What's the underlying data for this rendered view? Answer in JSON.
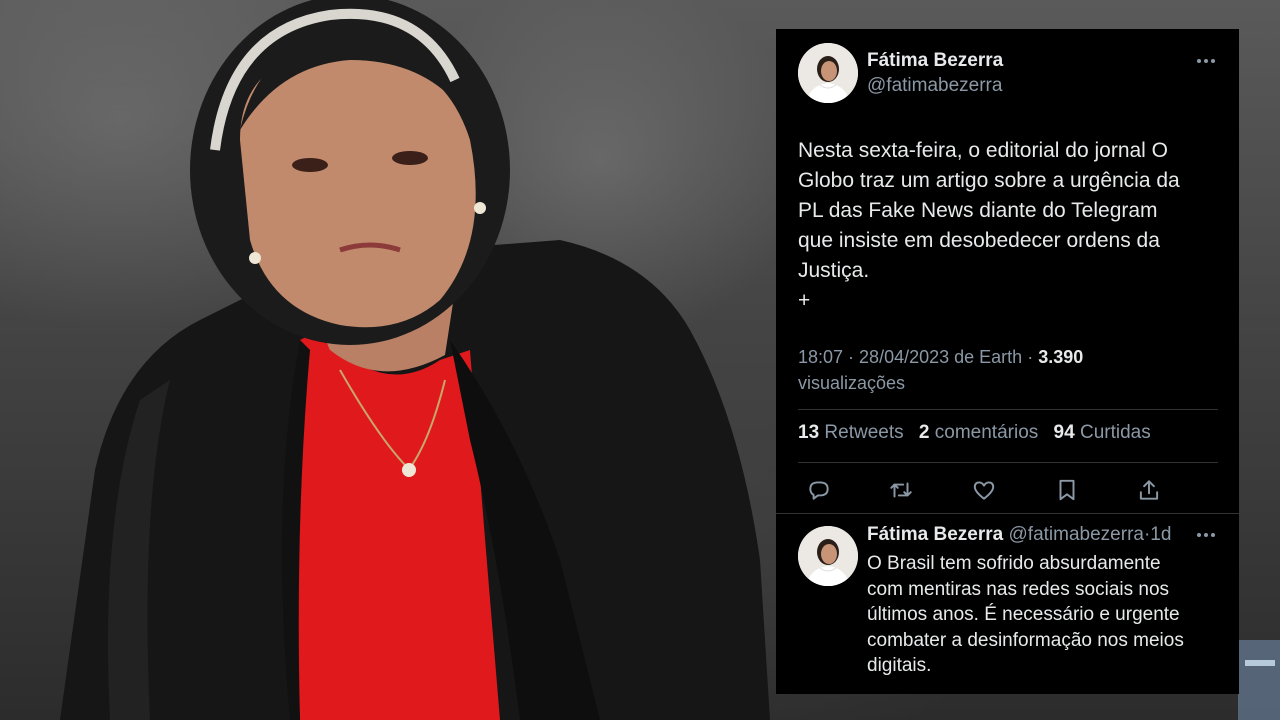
{
  "background": {
    "description_colors": {
      "jacket": "#151515",
      "top": "#e0191c",
      "hair": "#1b1b1b"
    }
  },
  "tweet": {
    "author": {
      "display_name": "Fátima Bezerra",
      "handle": "@fatimabezerra",
      "avatar_icon": "profile-avatar"
    },
    "text_lines": [
      "Nesta sexta-feira, o editorial do jornal O",
      "Globo traz um artigo sobre a urgência da",
      "PL das Fake News diante do Telegram",
      "que insiste em desobedecer ordens da",
      "Justiça.",
      "+"
    ],
    "time": "18:07",
    "date": "28/04/2023 de Earth",
    "views_count": "3.390",
    "views_label": "visualizações",
    "stats": {
      "retweets_count": "13",
      "retweets_label": "Retweets",
      "comments_count": "2",
      "comments_label": "comentários",
      "likes_count": "94",
      "likes_label": "Curtidas"
    },
    "actions": [
      "reply-icon",
      "retweet-icon",
      "like-icon",
      "bookmark-icon",
      "share-icon"
    ]
  },
  "reply": {
    "display_name": "Fátima Bezerra",
    "handle": "@fatimabezerra",
    "time_ago": "1d",
    "text_lines": [
      "O Brasil tem sofrido absurdamente",
      "com mentiras nas redes sociais nos",
      "últimos anos. É necessário e urgente",
      "combater a desinformação nos meios",
      "digitais."
    ]
  },
  "colors": {
    "panel_bg": "#000000",
    "primary_text": "#e7e9ea",
    "secondary_text": "#8b98a5",
    "divider": "#2f3336"
  }
}
